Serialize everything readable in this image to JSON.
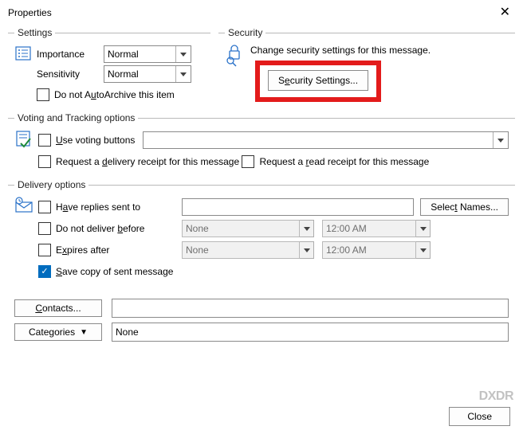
{
  "window": {
    "title": "Properties",
    "close_label": "Close"
  },
  "settings": {
    "legend": "Settings",
    "importance_label": "Importance",
    "importance_value": "Normal",
    "sensitivity_label": "Sensitivity",
    "sensitivity_value": "Normal",
    "autoarchive_label": "Do not AutoArchive this item"
  },
  "security": {
    "legend": "Security",
    "desc": "Change security settings for this message.",
    "button": "Security Settings..."
  },
  "voting": {
    "legend": "Voting and Tracking options",
    "use_voting": "Use voting buttons",
    "voting_value": "",
    "delivery_receipt": "Request a delivery receipt for this message",
    "read_receipt": "Request a read receipt for this message"
  },
  "delivery": {
    "legend": "Delivery options",
    "replies_to": "Have replies sent to",
    "replies_value": "",
    "select_names": "Select Names...",
    "no_deliver_before": "Do not deliver before",
    "no_deliver_date": "None",
    "no_deliver_time": "12:00 AM",
    "expires_after": "Expires after",
    "expires_date": "None",
    "expires_time": "12:00 AM",
    "save_copy": "Save copy of sent message"
  },
  "bottom": {
    "contacts": "Contacts...",
    "contacts_value": "",
    "categories": "Categories",
    "categories_value": "None"
  },
  "watermark": "DXDR"
}
